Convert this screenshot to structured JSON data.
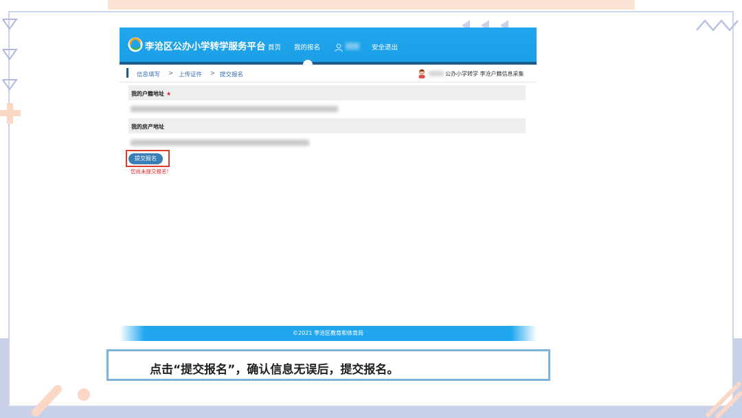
{
  "header": {
    "site_title": "李沧区公办小学转学服务平台",
    "nav": [
      "首页",
      "我的报名",
      "安全退出"
    ]
  },
  "breadcrumb": {
    "steps": [
      "信息填写",
      "上传证件",
      "提交报名"
    ],
    "separator": ">",
    "user_info": "公办小学转学 李沧户籍信息采集"
  },
  "form": {
    "household_label": "我的户籍地址",
    "required_mark": "★",
    "property_label": "我的房产地址",
    "submit_label": "提交报名",
    "warning": "您尚未提交报名!"
  },
  "footer": {
    "text": "©2021 李沧区教育和体育局"
  },
  "caption": {
    "text": "点击“提交报名”，确认信息无误后，提交报名。"
  },
  "colors": {
    "header_blue": "#22a7ee",
    "highlight_red": "#e03b2a",
    "caption_border": "#7bb3df"
  },
  "icons": [
    "logo-icon",
    "user-icon",
    "person-icon"
  ]
}
